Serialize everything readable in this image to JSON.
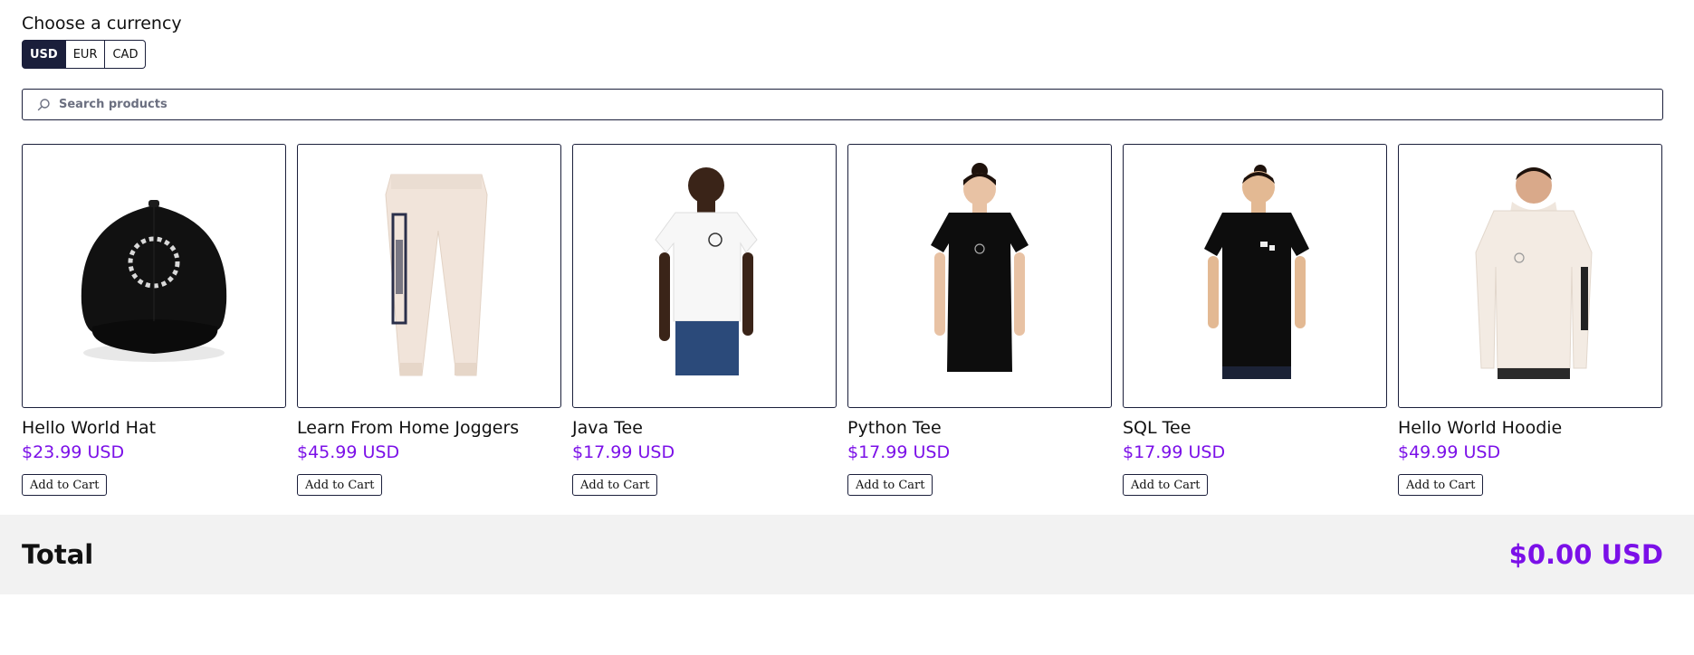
{
  "currency": {
    "label": "Choose a currency",
    "options": [
      "USD",
      "EUR",
      "CAD"
    ],
    "selected": "USD"
  },
  "search": {
    "placeholder": "Search products",
    "value": ""
  },
  "products": [
    {
      "name": "Hello World Hat",
      "price": "$23.99 USD",
      "button": "Add to Cart",
      "image_icon": "hat-image"
    },
    {
      "name": "Learn From Home Joggers",
      "price": "$45.99 USD",
      "button": "Add to Cart",
      "image_icon": "joggers-image"
    },
    {
      "name": "Java Tee",
      "price": "$17.99 USD",
      "button": "Add to Cart",
      "image_icon": "white-tee-image"
    },
    {
      "name": "Python Tee",
      "price": "$17.99 USD",
      "button": "Add to Cart",
      "image_icon": "black-tee-image"
    },
    {
      "name": "SQL Tee",
      "price": "$17.99 USD",
      "button": "Add to Cart",
      "image_icon": "black-tee-image"
    },
    {
      "name": "Hello World Hoodie",
      "price": "$49.99 USD",
      "button": "Add to Cart",
      "image_icon": "hoodie-image"
    }
  ],
  "total": {
    "label": "Total",
    "value": "$0.00 USD"
  },
  "colors": {
    "accent": "#7b10e8",
    "navy": "#1b1f3b",
    "total_bg": "#f2f2f2"
  }
}
